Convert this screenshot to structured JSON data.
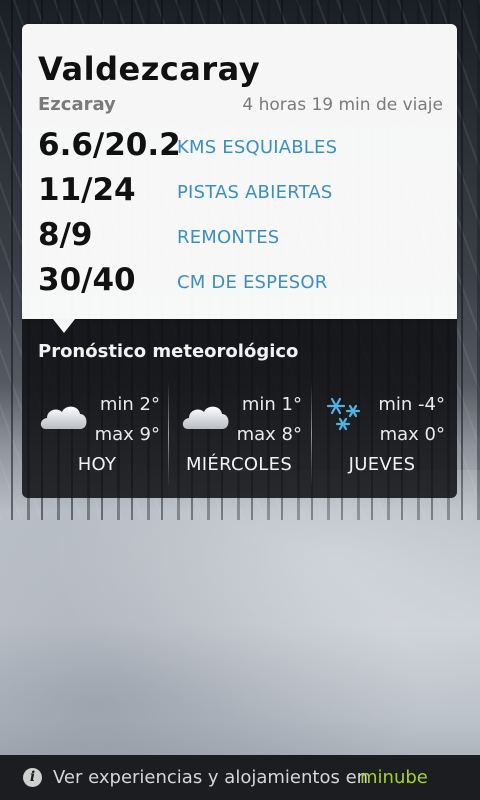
{
  "resort": {
    "name": "Valdezcaray",
    "town": "Ezcaray",
    "travel_time": "4 horas 19 min de viaje"
  },
  "stats": [
    {
      "value": "6.6/20.2",
      "label": "KMS ESQUIABLES"
    },
    {
      "value": "11/24",
      "label": "PISTAS ABIERTAS"
    },
    {
      "value": "8/9",
      "label": "REMONTES"
    },
    {
      "value": "30/40",
      "label": "CM DE ESPESOR"
    }
  ],
  "forecast": {
    "title": "Pronóstico meteorológico",
    "days": [
      {
        "name": "HOY",
        "min": "min 2°",
        "max": "max 9°",
        "icon": "cloud-icon"
      },
      {
        "name": "MIÉRCOLES",
        "min": "min 1°",
        "max": "max 8°",
        "icon": "cloud-icon"
      },
      {
        "name": "JUEVES",
        "min": "min -4°",
        "max": "max 0°",
        "icon": "snow-icon"
      }
    ]
  },
  "footer": {
    "text": "Ver experiencias y alojamientos en",
    "brand": "minube",
    "brand_color": "#a6d12b",
    "icon": "info-icon"
  },
  "colors": {
    "label_blue": "#3c8fbd",
    "snowflake_blue": "#4fb3e6"
  }
}
